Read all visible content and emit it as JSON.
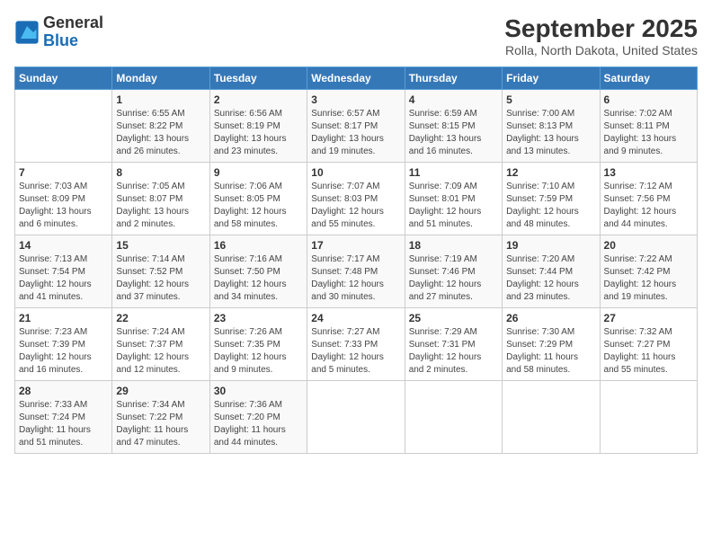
{
  "header": {
    "logo_line1": "General",
    "logo_line2": "Blue",
    "title": "September 2025",
    "subtitle": "Rolla, North Dakota, United States"
  },
  "calendar": {
    "weekdays": [
      "Sunday",
      "Monday",
      "Tuesday",
      "Wednesday",
      "Thursday",
      "Friday",
      "Saturday"
    ],
    "weeks": [
      [
        {
          "day": "",
          "info": ""
        },
        {
          "day": "1",
          "info": "Sunrise: 6:55 AM\nSunset: 8:22 PM\nDaylight: 13 hours\nand 26 minutes."
        },
        {
          "day": "2",
          "info": "Sunrise: 6:56 AM\nSunset: 8:19 PM\nDaylight: 13 hours\nand 23 minutes."
        },
        {
          "day": "3",
          "info": "Sunrise: 6:57 AM\nSunset: 8:17 PM\nDaylight: 13 hours\nand 19 minutes."
        },
        {
          "day": "4",
          "info": "Sunrise: 6:59 AM\nSunset: 8:15 PM\nDaylight: 13 hours\nand 16 minutes."
        },
        {
          "day": "5",
          "info": "Sunrise: 7:00 AM\nSunset: 8:13 PM\nDaylight: 13 hours\nand 13 minutes."
        },
        {
          "day": "6",
          "info": "Sunrise: 7:02 AM\nSunset: 8:11 PM\nDaylight: 13 hours\nand 9 minutes."
        }
      ],
      [
        {
          "day": "7",
          "info": "Sunrise: 7:03 AM\nSunset: 8:09 PM\nDaylight: 13 hours\nand 6 minutes."
        },
        {
          "day": "8",
          "info": "Sunrise: 7:05 AM\nSunset: 8:07 PM\nDaylight: 13 hours\nand 2 minutes."
        },
        {
          "day": "9",
          "info": "Sunrise: 7:06 AM\nSunset: 8:05 PM\nDaylight: 12 hours\nand 58 minutes."
        },
        {
          "day": "10",
          "info": "Sunrise: 7:07 AM\nSunset: 8:03 PM\nDaylight: 12 hours\nand 55 minutes."
        },
        {
          "day": "11",
          "info": "Sunrise: 7:09 AM\nSunset: 8:01 PM\nDaylight: 12 hours\nand 51 minutes."
        },
        {
          "day": "12",
          "info": "Sunrise: 7:10 AM\nSunset: 7:59 PM\nDaylight: 12 hours\nand 48 minutes."
        },
        {
          "day": "13",
          "info": "Sunrise: 7:12 AM\nSunset: 7:56 PM\nDaylight: 12 hours\nand 44 minutes."
        }
      ],
      [
        {
          "day": "14",
          "info": "Sunrise: 7:13 AM\nSunset: 7:54 PM\nDaylight: 12 hours\nand 41 minutes."
        },
        {
          "day": "15",
          "info": "Sunrise: 7:14 AM\nSunset: 7:52 PM\nDaylight: 12 hours\nand 37 minutes."
        },
        {
          "day": "16",
          "info": "Sunrise: 7:16 AM\nSunset: 7:50 PM\nDaylight: 12 hours\nand 34 minutes."
        },
        {
          "day": "17",
          "info": "Sunrise: 7:17 AM\nSunset: 7:48 PM\nDaylight: 12 hours\nand 30 minutes."
        },
        {
          "day": "18",
          "info": "Sunrise: 7:19 AM\nSunset: 7:46 PM\nDaylight: 12 hours\nand 27 minutes."
        },
        {
          "day": "19",
          "info": "Sunrise: 7:20 AM\nSunset: 7:44 PM\nDaylight: 12 hours\nand 23 minutes."
        },
        {
          "day": "20",
          "info": "Sunrise: 7:22 AM\nSunset: 7:42 PM\nDaylight: 12 hours\nand 19 minutes."
        }
      ],
      [
        {
          "day": "21",
          "info": "Sunrise: 7:23 AM\nSunset: 7:39 PM\nDaylight: 12 hours\nand 16 minutes."
        },
        {
          "day": "22",
          "info": "Sunrise: 7:24 AM\nSunset: 7:37 PM\nDaylight: 12 hours\nand 12 minutes."
        },
        {
          "day": "23",
          "info": "Sunrise: 7:26 AM\nSunset: 7:35 PM\nDaylight: 12 hours\nand 9 minutes."
        },
        {
          "day": "24",
          "info": "Sunrise: 7:27 AM\nSunset: 7:33 PM\nDaylight: 12 hours\nand 5 minutes."
        },
        {
          "day": "25",
          "info": "Sunrise: 7:29 AM\nSunset: 7:31 PM\nDaylight: 12 hours\nand 2 minutes."
        },
        {
          "day": "26",
          "info": "Sunrise: 7:30 AM\nSunset: 7:29 PM\nDaylight: 11 hours\nand 58 minutes."
        },
        {
          "day": "27",
          "info": "Sunrise: 7:32 AM\nSunset: 7:27 PM\nDaylight: 11 hours\nand 55 minutes."
        }
      ],
      [
        {
          "day": "28",
          "info": "Sunrise: 7:33 AM\nSunset: 7:24 PM\nDaylight: 11 hours\nand 51 minutes."
        },
        {
          "day": "29",
          "info": "Sunrise: 7:34 AM\nSunset: 7:22 PM\nDaylight: 11 hours\nand 47 minutes."
        },
        {
          "day": "30",
          "info": "Sunrise: 7:36 AM\nSunset: 7:20 PM\nDaylight: 11 hours\nand 44 minutes."
        },
        {
          "day": "",
          "info": ""
        },
        {
          "day": "",
          "info": ""
        },
        {
          "day": "",
          "info": ""
        },
        {
          "day": "",
          "info": ""
        }
      ]
    ]
  }
}
